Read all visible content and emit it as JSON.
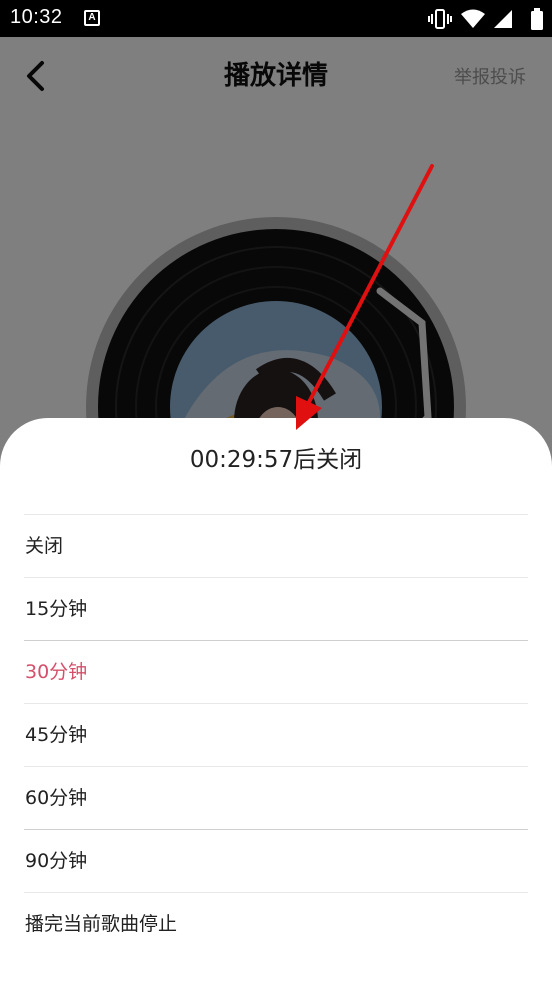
{
  "status_bar": {
    "time": "10:32",
    "notification_icon": "a-box-icon",
    "icons": [
      "vibrate-icon",
      "wifi-icon",
      "signal-icon",
      "battery-icon"
    ]
  },
  "header": {
    "back_icon": "chevron-left-icon",
    "title": "播放详情",
    "report_label": "举报投诉"
  },
  "sheet": {
    "title": "00:29:57后关闭",
    "options": [
      {
        "label": "关闭"
      },
      {
        "label": "15分钟"
      },
      {
        "label": "30分钟"
      },
      {
        "label": "45分钟"
      },
      {
        "label": "60分钟"
      },
      {
        "label": "90分钟"
      },
      {
        "label": "播完当前歌曲停止"
      }
    ],
    "selected_label": "30分钟"
  },
  "colors": {
    "selected": "#d4506a",
    "annotation_arrow": "#e01010"
  }
}
